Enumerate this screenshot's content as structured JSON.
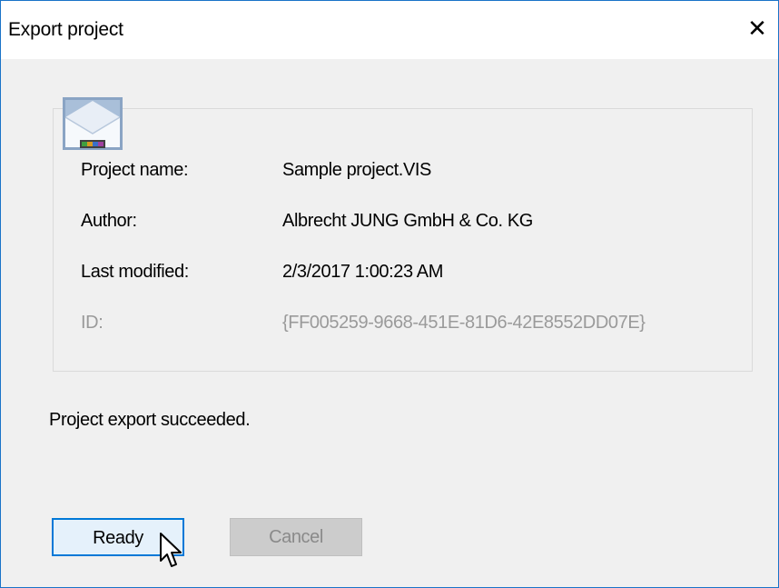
{
  "window": {
    "title": "Export project",
    "close_glyph": "✕"
  },
  "project_info": {
    "icon": "project-file-icon",
    "fields": [
      {
        "label": "Project name:",
        "value": "Sample project.VIS",
        "enabled": true
      },
      {
        "label": "Author:",
        "value": "Albrecht JUNG GmbH & Co. KG",
        "enabled": true
      },
      {
        "label": "Last modified:",
        "value": "2/3/2017 1:00:23 AM",
        "enabled": true
      },
      {
        "label": "ID:",
        "value": "{FF005259-9668-451E-81D6-42E8552DD07E}",
        "enabled": false
      }
    ]
  },
  "status": {
    "message": "Project export succeeded."
  },
  "buttons": {
    "ready_label": "Ready",
    "cancel_label": "Cancel",
    "cancel_enabled": false
  },
  "colors": {
    "accent": "#0078d7",
    "window_border": "#1a73c8",
    "disabled_text": "#9a9a9a"
  }
}
